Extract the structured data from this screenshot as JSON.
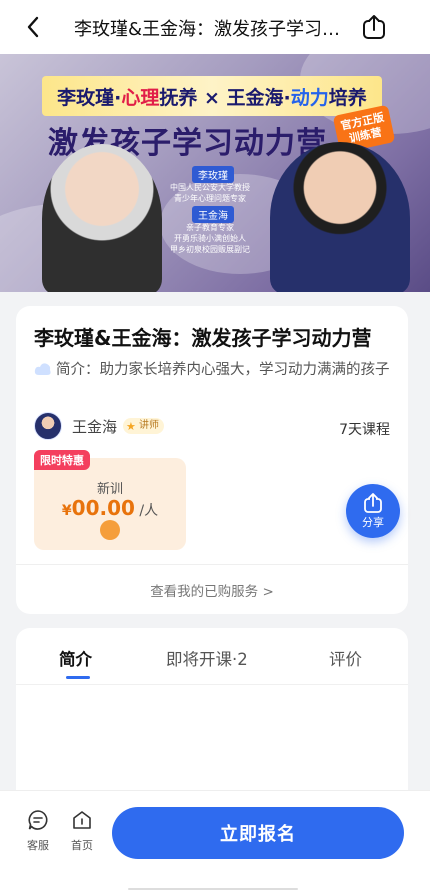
{
  "nav": {
    "title": "李玫瑾&王金海：激发孩子学习动力营",
    "back_icon": "chevron-left-icon",
    "share_icon": "share-icon"
  },
  "banner": {
    "top_line_a": "李玫瑾·",
    "top_line_hl1": "心理",
    "top_line_b": "抚养 × 王金海·",
    "top_line_hl2": "动力",
    "top_line_c": "培养",
    "headline": "激发孩子学习动力营",
    "badge": "官方正版\n训练营",
    "person1_name": "李玫瑾",
    "person1_desc": "中国人民公安大学教授\n青少年心理问题专家",
    "person2_name": "王金海",
    "person2_desc": "亲子教育专家\n开勇乐骑小满创始人\n甲乡初泉校园贩展副记"
  },
  "course": {
    "title": "李玫瑾&王金海：激发孩子学习动力营",
    "intro": "简介：助力家长培养内心强大，学习动力满满的孩子",
    "teacher_name": "王金海",
    "teacher_tag": "讲师",
    "duration": "7天课程",
    "promo_ribbon": "限时特惠",
    "plan_name": "新训",
    "currency": "¥",
    "price": "00.00",
    "price_unit": " /人",
    "share_label": "分享",
    "purchased_link": "查看我的已购服务 >"
  },
  "tabs": [
    {
      "label": "简介",
      "active": true
    },
    {
      "label": "即将开课·2",
      "active": false
    },
    {
      "label": "评价",
      "active": false
    }
  ],
  "bottom": {
    "service_label": "客服",
    "home_label": "首页",
    "cta_label": "立即报名"
  },
  "colors": {
    "accent": "#2f6bef",
    "price": "#e8730c",
    "ribbon": "#f43f5e"
  }
}
